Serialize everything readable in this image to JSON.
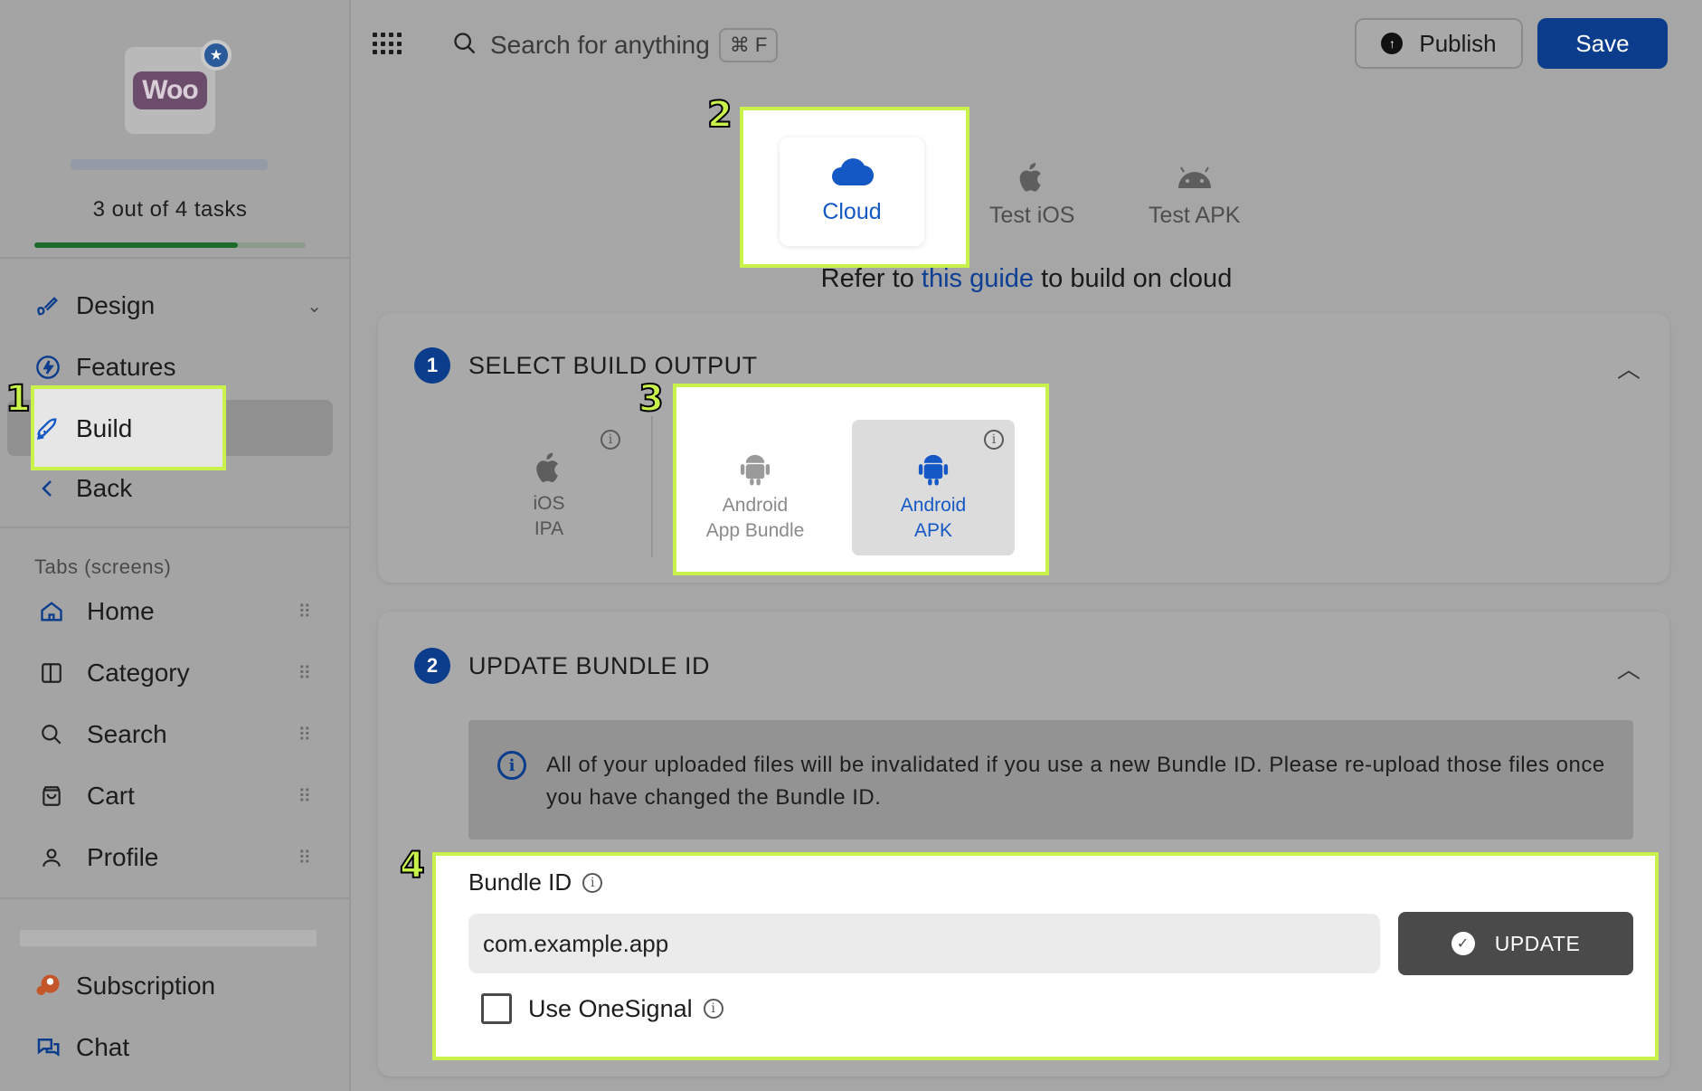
{
  "sidebar": {
    "tasks": "3 out of 4 tasks",
    "progress": 0.75,
    "nav": [
      {
        "label": "Design",
        "icon": "brush-icon"
      },
      {
        "label": "Features",
        "icon": "lightning-icon"
      },
      {
        "label": "Build",
        "icon": "rocket-icon"
      },
      {
        "label": "Back",
        "icon": "chevron-left-icon"
      }
    ],
    "tabs_label": "Tabs (screens)",
    "tabs": [
      {
        "label": "Home",
        "icon": "home-icon"
      },
      {
        "label": "Category",
        "icon": "columns-icon"
      },
      {
        "label": "Search",
        "icon": "search-icon"
      },
      {
        "label": "Cart",
        "icon": "bag-icon"
      },
      {
        "label": "Profile",
        "icon": "user-icon"
      }
    ],
    "bottom": [
      {
        "label": "Subscription",
        "icon": "subscription-icon"
      },
      {
        "label": "Chat",
        "icon": "chat-icon"
      }
    ],
    "logo_text": "Woo"
  },
  "topbar": {
    "search_placeholder": "Search for anything",
    "shortcut": "⌘ F",
    "publish": "Publish",
    "save": "Save"
  },
  "targets": {
    "cloud": "Cloud",
    "ios": "Test iOS",
    "apk": "Test APK",
    "refer_prefix": "Refer to ",
    "refer_link": "this guide",
    "refer_suffix": " to build on cloud"
  },
  "step1": {
    "number": "1",
    "title": "SELECT BUILD OUTPUT",
    "options": [
      {
        "line1": "iOS",
        "line2": "IPA"
      },
      {
        "line1": "Android",
        "line2": "App Bundle"
      },
      {
        "line1": "Android",
        "line2": "APK"
      }
    ]
  },
  "step2": {
    "number": "2",
    "title": "UPDATE BUNDLE ID",
    "notice": "All of your uploaded files will be invalidated if you use a new Bundle ID. Please re-upload those files once you have changed the Bundle ID.",
    "bundle_label": "Bundle ID",
    "bundle_value": "com.example.app",
    "update": "UPDATE",
    "onesignal": "Use OneSignal"
  },
  "markers": [
    "1",
    "2",
    "3",
    "4"
  ],
  "colors": {
    "accent": "#0b3d8c",
    "highlight": "#c9f24a",
    "link": "#1458c5"
  }
}
